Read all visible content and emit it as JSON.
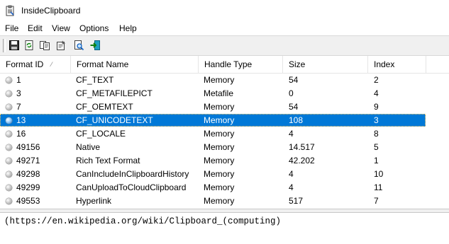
{
  "window": {
    "title": "InsideClipboard"
  },
  "menu": [
    "File",
    "Edit",
    "View",
    "Options",
    "Help"
  ],
  "toolbar": {
    "buttons": [
      "save-icon",
      "refresh-icon",
      "copy-icon",
      "properties-icon",
      "find-icon",
      "exit-icon"
    ]
  },
  "table": {
    "columns": [
      "Format ID",
      "Format Name",
      "Handle Type",
      "Size",
      "Index"
    ],
    "sort": {
      "column": "Format ID",
      "direction": "ascending"
    },
    "rows": [
      {
        "id": "1",
        "name": "CF_TEXT",
        "handle": "Memory",
        "size": "54",
        "index": "2"
      },
      {
        "id": "3",
        "name": "CF_METAFILEPICT",
        "handle": "Metafile",
        "size": "0",
        "index": "4"
      },
      {
        "id": "7",
        "name": "CF_OEMTEXT",
        "handle": "Memory",
        "size": "54",
        "index": "9"
      },
      {
        "id": "13",
        "name": "CF_UNICODETEXT",
        "handle": "Memory",
        "size": "108",
        "index": "3",
        "selected": true
      },
      {
        "id": "16",
        "name": "CF_LOCALE",
        "handle": "Memory",
        "size": "4",
        "index": "8"
      },
      {
        "id": "49156",
        "name": "Native",
        "handle": "Memory",
        "size": "14.517",
        "index": "5"
      },
      {
        "id": "49271",
        "name": "Rich Text Format",
        "handle": "Memory",
        "size": "42.202",
        "index": "1"
      },
      {
        "id": "49298",
        "name": "CanIncludeInClipboardHistory",
        "handle": "Memory",
        "size": "4",
        "index": "10"
      },
      {
        "id": "49299",
        "name": "CanUploadToCloudClipboard",
        "handle": "Memory",
        "size": "4",
        "index": "11"
      },
      {
        "id": "49553",
        "name": "Hyperlink",
        "handle": "Memory",
        "size": "517",
        "index": "7"
      }
    ]
  },
  "content": {
    "text": "(https://en.wikipedia.org/wiki/Clipboard_(computing)"
  },
  "colors": {
    "selection": "#0078d7",
    "toolbar": "#f0f0f0",
    "window": "#ffffff"
  }
}
